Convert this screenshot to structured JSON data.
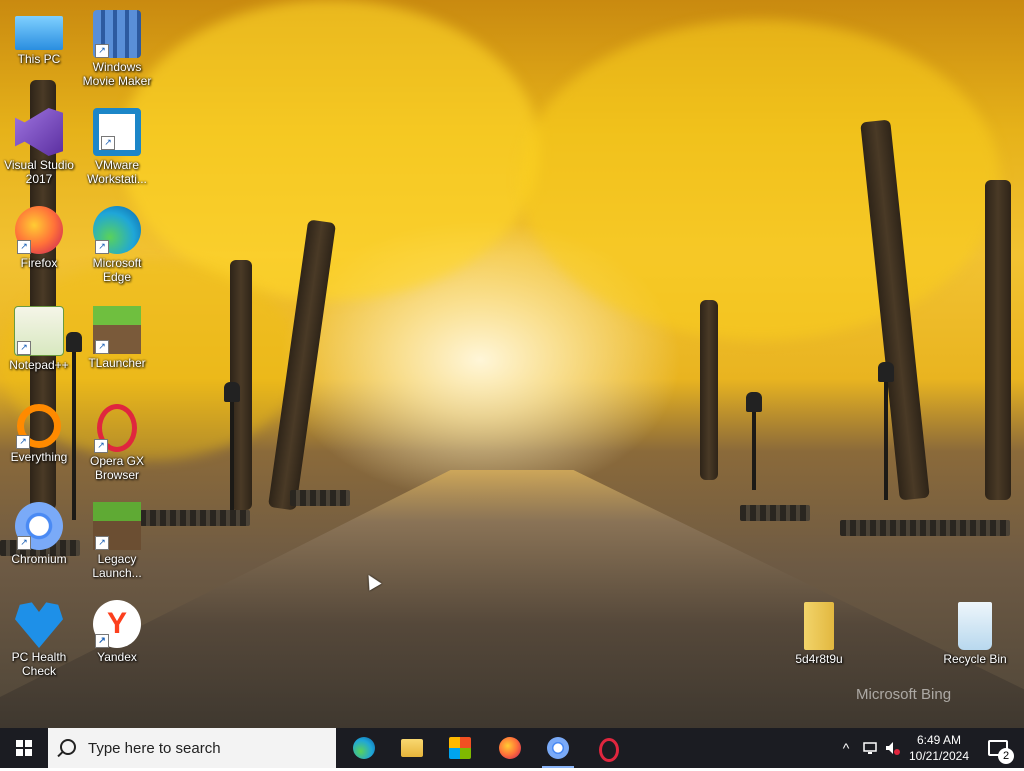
{
  "desktop": {
    "icons": [
      {
        "label": "This PC",
        "icon": "computer-icon",
        "color": "#3da9f5"
      },
      {
        "label": "Windows Movie Maker",
        "icon": "film-icon",
        "color": "#5a8fd8"
      },
      {
        "label": "Visual Studio 2017",
        "icon": "visual-studio-icon",
        "color": "#865fc5"
      },
      {
        "label": "VMware Workstati...",
        "icon": "vmware-icon",
        "color": "#1c86c8"
      },
      {
        "label": "Firefox",
        "icon": "firefox-icon",
        "color": "#ff7139"
      },
      {
        "label": "Microsoft Edge",
        "icon": "edge-icon",
        "color": "#1fa6d8"
      },
      {
        "label": "Notepad++",
        "icon": "notepad-icon",
        "color": "#90c85a"
      },
      {
        "label": "TLauncher",
        "icon": "minecraft-block-icon",
        "color": "#5f9f3a"
      },
      {
        "label": "Everything",
        "icon": "search-ring-icon",
        "color": "#ff8a00"
      },
      {
        "label": "Opera GX Browser",
        "icon": "opera-gx-icon",
        "color": "#e0263e"
      },
      {
        "label": "Chromium",
        "icon": "chromium-icon",
        "color": "#4a8af4"
      },
      {
        "label": "Legacy Launch...",
        "icon": "minecraft-block-icon",
        "color": "#4f8f32"
      },
      {
        "label": "PC Health Check",
        "icon": "heart-pulse-icon",
        "color": "#1e90e8"
      },
      {
        "label": "Yandex",
        "icon": "yandex-icon",
        "color": "#fc3f1d"
      },
      {
        "label": "5d4r8t9u",
        "icon": "folder-zip-icon",
        "color": "#f2d46a"
      },
      {
        "label": "Recycle Bin",
        "icon": "recycle-bin-icon",
        "color": "#cfe6f5"
      }
    ],
    "watermark": "Microsoft Bing"
  },
  "taskbar": {
    "search_placeholder": "Type here to search",
    "apps": [
      {
        "name": "Microsoft Edge",
        "icon": "edge-icon",
        "color": "#1fa6d8"
      },
      {
        "name": "File Explorer",
        "icon": "folder-icon",
        "color": "#f4c542"
      },
      {
        "name": "Microsoft Store",
        "icon": "store-icon",
        "color": "#4aa0e6"
      },
      {
        "name": "Firefox",
        "icon": "firefox-icon",
        "color": "#ff7139"
      },
      {
        "name": "Chromium",
        "icon": "chromium-icon",
        "color": "#4a8af4"
      },
      {
        "name": "Opera GX",
        "icon": "opera-icon",
        "color": "#e0263e"
      }
    ],
    "clock": {
      "time": "6:49 AM",
      "date": "10/21/2024"
    },
    "notification_count": "2"
  }
}
